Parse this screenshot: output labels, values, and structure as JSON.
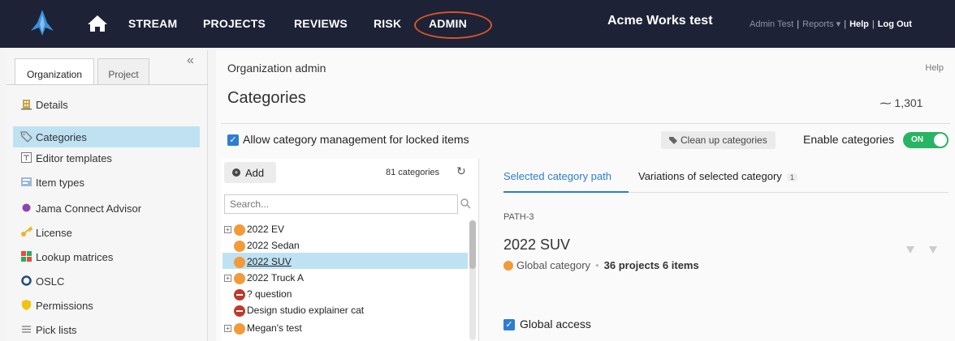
{
  "nav": {
    "items": [
      "STREAM",
      "PROJECTS",
      "REVIEWS",
      "RISK",
      "ADMIN"
    ],
    "app_title": "Acme Works test",
    "user": "Admin Test",
    "reports": "Reports",
    "help": "Help",
    "logout": "Log Out",
    "sep": "|"
  },
  "left": {
    "tabs": [
      "Organization",
      "Project"
    ],
    "collapse_glyph": "«",
    "items": [
      {
        "label": "Details",
        "icon": "building-icon"
      },
      {
        "label": "Categories",
        "icon": "tag-icon"
      },
      {
        "label": "Editor templates",
        "icon": "template-icon"
      },
      {
        "label": "Item types",
        "icon": "item-types-icon"
      },
      {
        "label": "Jama Connect Advisor",
        "icon": "advisor-icon"
      },
      {
        "label": "License",
        "icon": "key-icon"
      },
      {
        "label": "Lookup matrices",
        "icon": "matrix-icon"
      },
      {
        "label": "OSLC",
        "icon": "oslc-icon"
      },
      {
        "label": "Permissions",
        "icon": "shield-icon"
      },
      {
        "label": "Pick lists",
        "icon": "list-icon"
      }
    ]
  },
  "main": {
    "breadcrumb": "Organization admin",
    "help": "Help",
    "title": "Categories",
    "activity_count": "1,301",
    "allow_label": "Allow category management for locked items",
    "cleanup_label": "Clean up categories",
    "enable_label": "Enable categories",
    "toggle_text": "ON"
  },
  "tree": {
    "add_label": "Add",
    "count": "81 categories",
    "search_placeholder": "Search...",
    "rows": [
      {
        "label": "2022 EV",
        "icon": "globe",
        "expandable": true
      },
      {
        "label": "2022 Sedan",
        "icon": "globe",
        "expandable": false
      },
      {
        "label": "2022 SUV",
        "icon": "globe",
        "expandable": false,
        "selected": true
      },
      {
        "label": "2022 Truck A",
        "icon": "globe",
        "expandable": true
      },
      {
        "label": "? question",
        "icon": "stop",
        "expandable": false
      },
      {
        "label": "Design studio explainer cat",
        "icon": "stop",
        "expandable": false
      },
      {
        "label": "Megan's test",
        "icon": "globe",
        "expandable": true
      }
    ]
  },
  "detail": {
    "tab_path": "Selected category path",
    "tab_variations": "Variations of selected category",
    "variations_count": "1",
    "path_label": "PATH-3",
    "name": "2022 SUV",
    "scope": "Global category",
    "projects": "36 projects",
    "items": "6 items",
    "global_access": "Global access"
  },
  "colors": {
    "nav_bg": "#1d2236",
    "accent": "#2d7dd2",
    "selected_bg": "#bfe2f3",
    "toggle_on": "#28b463",
    "highlight_ring": "#d9542a"
  }
}
